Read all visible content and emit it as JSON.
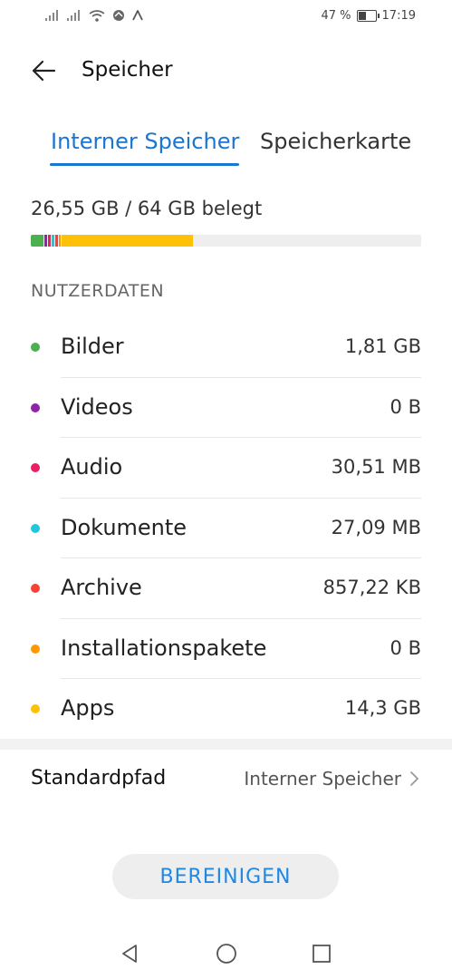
{
  "status_bar": {
    "battery_percent": "47 %",
    "battery_level": 0.47,
    "time": "17:19"
  },
  "header": {
    "title": "Speicher",
    "back_icon": "arrow-left-icon"
  },
  "tabs": [
    {
      "label": "Interner Speicher",
      "active": true
    },
    {
      "label": "Speicherkarte",
      "active": false
    }
  ],
  "usage": {
    "text": "26,55 GB / 64 GB belegt",
    "used_fraction": 0.415,
    "colors": {
      "bilder": "#4caf50",
      "videos": "#8e24aa",
      "audio": "#e91e63",
      "dokumente": "#26c6da",
      "archive": "#f44336",
      "installationspakete": "#ff9800",
      "apps": "#ffc107"
    }
  },
  "section": {
    "header": "NUTZERDATEN"
  },
  "categories": [
    {
      "label": "Bilder",
      "value": "1,81 GB",
      "color": "#4caf50"
    },
    {
      "label": "Videos",
      "value": "0 B",
      "color": "#8e24aa"
    },
    {
      "label": "Audio",
      "value": "30,51 MB",
      "color": "#e91e63"
    },
    {
      "label": "Dokumente",
      "value": "27,09 MB",
      "color": "#26c6da"
    },
    {
      "label": "Archive",
      "value": "857,22 KB",
      "color": "#f44336"
    },
    {
      "label": "Installationspakete",
      "value": "0 B",
      "color": "#ff9800"
    },
    {
      "label": "Apps",
      "value": "14,3 GB",
      "color": "#ffc107"
    }
  ],
  "default_path": {
    "label": "Standardpfad",
    "value": "Interner Speicher",
    "chevron_icon": "chevron-right-icon"
  },
  "actions": {
    "clean_label": "BEREINIGEN"
  },
  "nav_bar": {
    "back_icon": "triangle-back-icon",
    "home_icon": "circle-home-icon",
    "recents_icon": "square-recents-icon"
  },
  "accent_color": "#1976d2"
}
